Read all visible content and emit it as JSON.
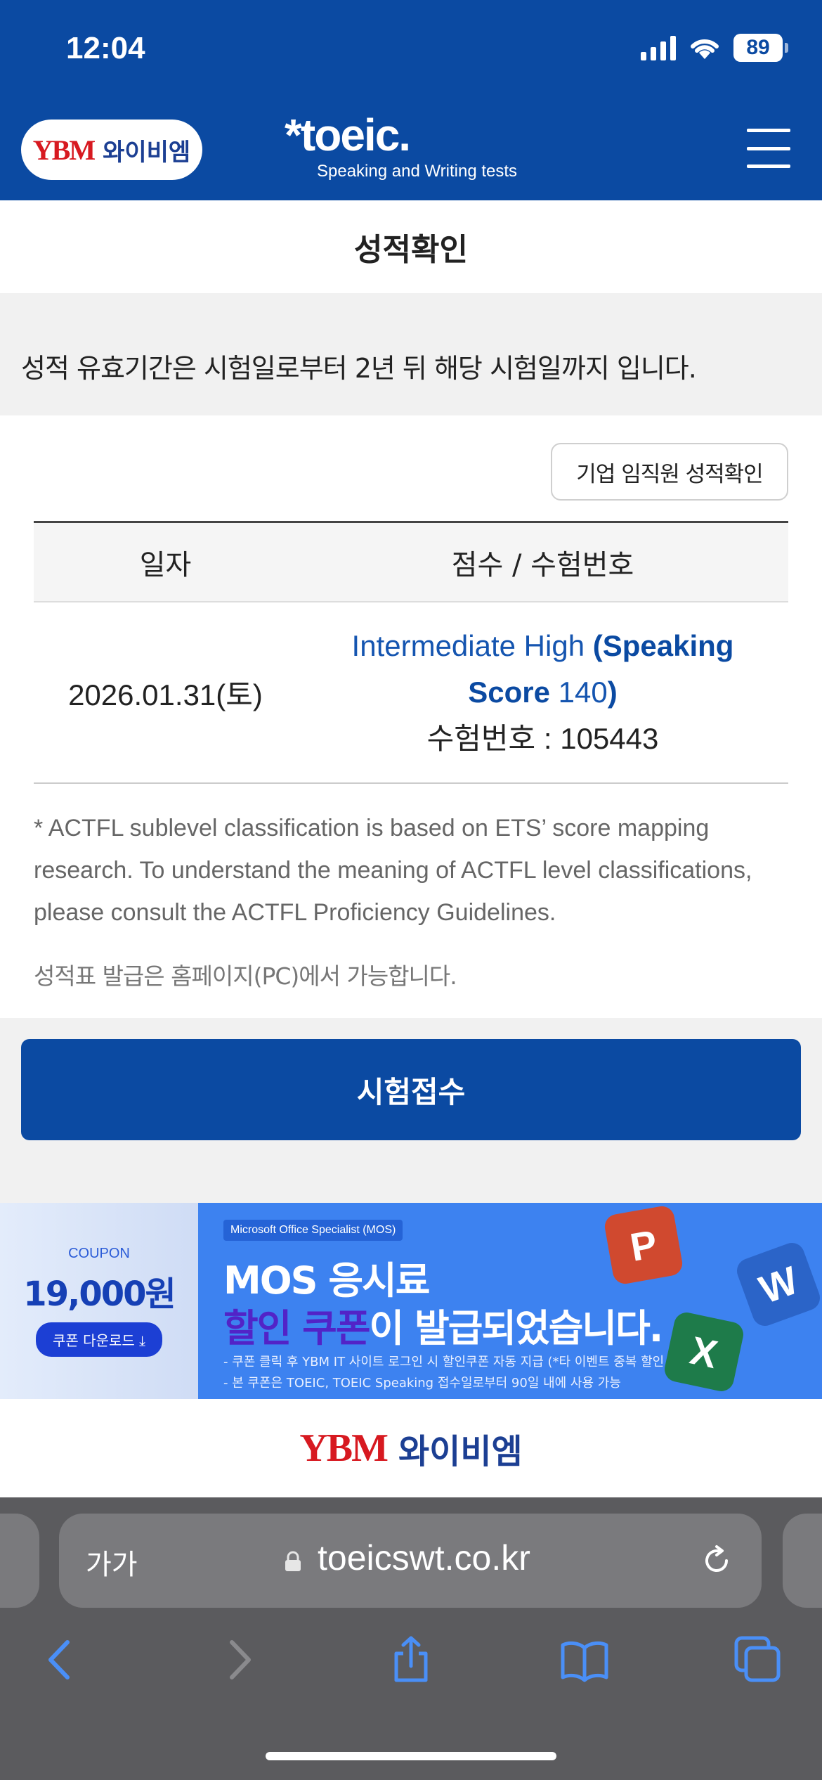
{
  "status_bar": {
    "time": "12:04",
    "battery": "89"
  },
  "header": {
    "ybm_mark": "YBM",
    "ybm_text": "와이비엠",
    "toeic_logo": "*toeic.",
    "toeic_sub": "Speaking and Writing tests"
  },
  "page": {
    "title": "성적확인",
    "notice": "성적 유효기간은 시험일로부터 2년 뒤 해당 시험일까지 입니다.",
    "corp_button": "기업 임직원 성적확인"
  },
  "table": {
    "headers": [
      "일자",
      "점수 / 수험번호"
    ],
    "rows": [
      {
        "date": "2026.01.31(토)",
        "level": "Intermediate High",
        "score_open": "(Speaking",
        "score_word": "Score",
        "score_value": "140",
        "score_close": ")",
        "exam_no": "수험번호 : 105443"
      }
    ]
  },
  "notes": {
    "actfl": "* ACTFL sublevel classification is based on ETS’ score mapping research. To understand the meaning of ACTFL level classifications, please consult the ACTFL Proficiency Guidelines.",
    "issue": "성적표 발급은 홈페이지(PC)에서 가능합니다."
  },
  "apply_button": "시험접수",
  "banner": {
    "coupon_label": "COUPON",
    "coupon_price": "19,000원",
    "coupon_button": "쿠폰 다운로드 ⤓",
    "mos_tag": "Microsoft Office Specialist (MOS)",
    "mos_title": "MOS 응시료",
    "mos_highlight": "할인 쿠폰",
    "mos_rest": "이 발급되었습니다.",
    "mos_note1": "- 쿠폰 클릭 후 YBM IT 사이트 로그인 시 할인쿠폰 자동 지급 (*타 이벤트 중복 할인 불가)",
    "mos_note2": "- 본 쿠폰은 TOEIC, TOEIC Speaking 접수일로부터 90일 내에 사용 가능",
    "app_p": "P",
    "app_w": "W",
    "app_x": "X"
  },
  "footer": {
    "ybm_mark": "YBM",
    "ybm_text": "와이비엠"
  },
  "browser": {
    "text_size": "가가",
    "url": "toeicswt.co.kr"
  },
  "colors": {
    "brand_blue": "#0b4aa2",
    "ybm_red": "#d71920",
    "safari_bg": "#5b5b5e"
  }
}
